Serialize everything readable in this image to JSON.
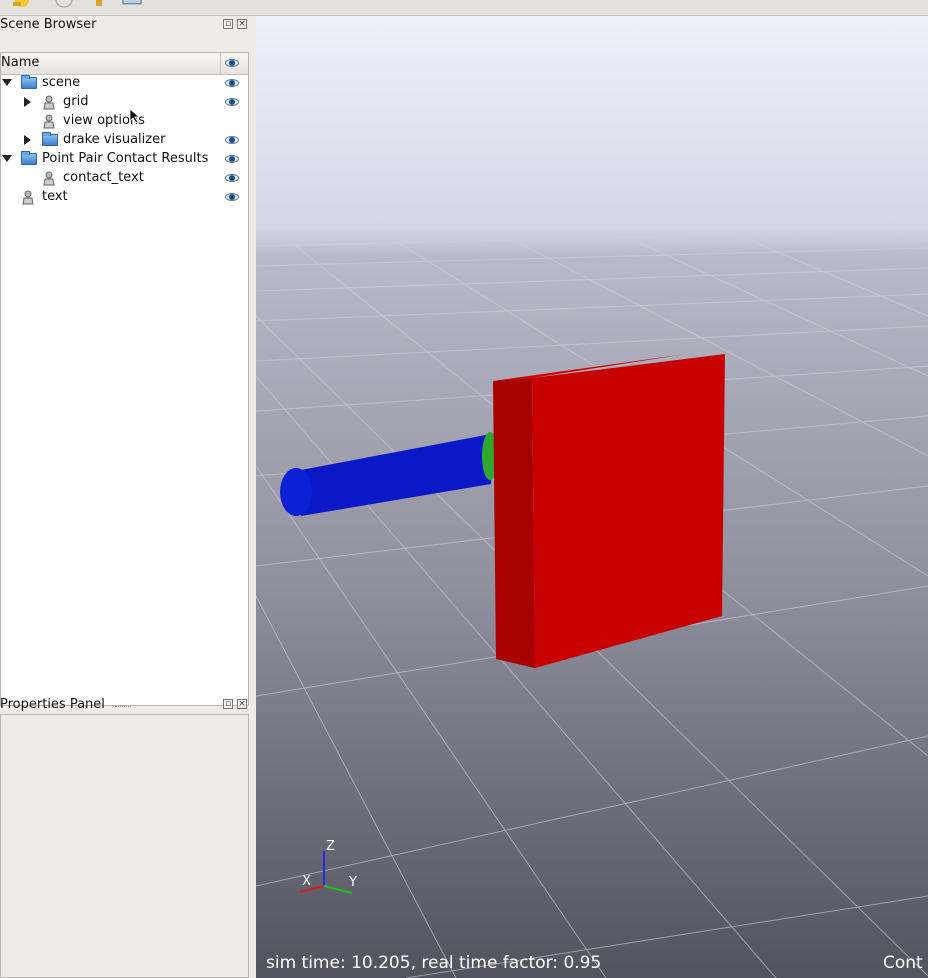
{
  "scene_browser": {
    "title": "Scene Browser",
    "column_header": "Name",
    "items": [
      {
        "label": "scene",
        "icon": "folder-icon",
        "expanded": true,
        "visible": true
      },
      {
        "label": "grid",
        "icon": "object-icon",
        "expanded": false,
        "visible": true
      },
      {
        "label": "view options",
        "icon": "object-icon",
        "visible": false
      },
      {
        "label": "drake visualizer",
        "icon": "folder-icon",
        "expanded": false,
        "visible": true
      },
      {
        "label": "Point Pair Contact Results",
        "icon": "folder-icon",
        "expanded": true,
        "visible": true
      },
      {
        "label": "contact_text",
        "icon": "object-icon",
        "visible": true
      },
      {
        "label": "text",
        "icon": "object-icon",
        "visible": true
      }
    ]
  },
  "properties_panel": {
    "title": "Properties Panel"
  },
  "viewport": {
    "status_text": "sim time: 10.205, real time factor: 0.95",
    "status_right_text": "Cont",
    "axes": {
      "x": "X",
      "y": "Y",
      "z": "Z"
    },
    "colors": {
      "box": "#c80000",
      "cylinder": "#0a18c8",
      "contact": "#2fa82f",
      "sky_top": "#eef0fa",
      "ground_far": "#b8b8c8",
      "ground_near": "#53535f"
    }
  }
}
